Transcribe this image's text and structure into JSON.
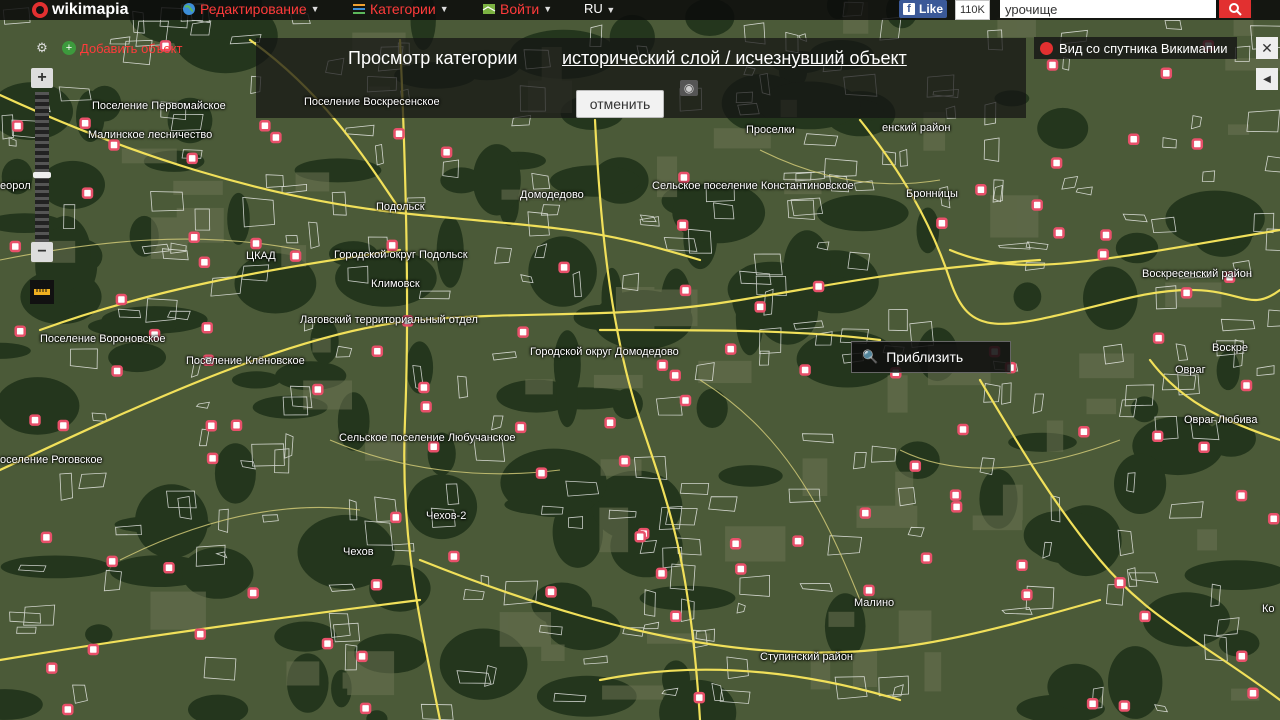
{
  "topbar": {
    "logo": "wikimapia",
    "menu": [
      {
        "label": "Редактирование",
        "icon": "globe-icon"
      },
      {
        "label": "Категории",
        "icon": "list-icon"
      },
      {
        "label": "Войти",
        "icon": "map-icon"
      }
    ],
    "language": "RU",
    "facebook": {
      "label": "Like",
      "count": "110K"
    },
    "search": {
      "value": "урочище"
    }
  },
  "left_controls": {
    "add_object": "Добавить объект"
  },
  "category_banner": {
    "title": "Просмотр категории",
    "category": "исторический слой / исчезнувший объект",
    "cancel": "отменить"
  },
  "right_controls": {
    "satellite_view": "Вид со спутника Викимапии",
    "close": "✕",
    "collapse": "◀"
  },
  "tooltip": {
    "label": "Приблизить"
  },
  "map_labels": [
    "Поселение Первомайское",
    "Малинское лесничество",
    "Поселение Воскресенское",
    "Подольск",
    "ЦКАД",
    "Городской округ Подольск",
    "Климовск",
    "Лаговский территориальный отдел",
    "Поселение Вороновское",
    "Поселение Клёновское",
    "Сельское поселение Любучанское",
    "оселение Роговское",
    "Чехов-2",
    "Чехов",
    "Домодедово",
    "Городской округ Домодедово",
    "Сельское поселение Константиновское",
    "Проселки",
    "Бронницы",
    "Воскресенский район",
    "Овраг",
    "Овраг Любива",
    "Малино",
    "Ступинский район",
    "еорол",
    "енский район",
    "Воскре",
    "Ко"
  ],
  "colors": {
    "accent": "#e23030",
    "roads": "#f1e05a",
    "parcel_outlines": "#ffffff",
    "markers": "#e8506a",
    "forest": "#24361d",
    "fields": "#4b5a38"
  }
}
